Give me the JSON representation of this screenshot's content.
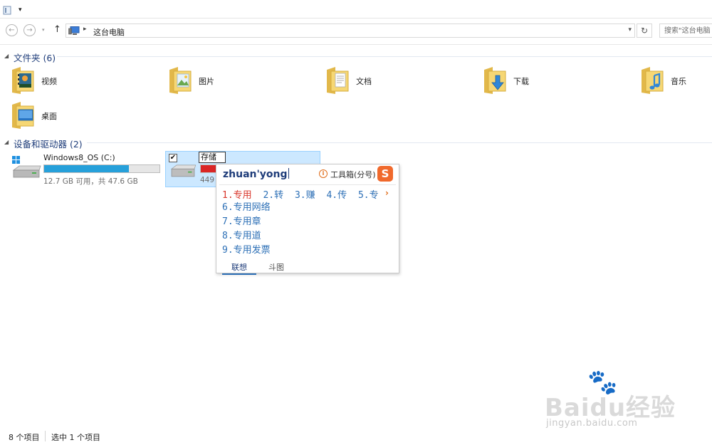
{
  "window": {
    "address_path": "这台电脑",
    "search_placeholder": "搜索\"这台电脑"
  },
  "sections": {
    "folders_title": "文件夹 (6)",
    "devices_title": "设备和驱动器 (2)"
  },
  "folders": [
    {
      "label": "视频",
      "icon": "videos-folder-icon"
    },
    {
      "label": "图片",
      "icon": "pictures-folder-icon"
    },
    {
      "label": "文档",
      "icon": "documents-folder-icon"
    },
    {
      "label": "下载",
      "icon": "downloads-folder-icon"
    },
    {
      "label": "音乐",
      "icon": "music-folder-icon"
    },
    {
      "label": "桌面",
      "icon": "desktop-folder-icon"
    }
  ],
  "drives": [
    {
      "name": "Windows8_OS (C:)",
      "free": "12.7 GB 可用，共 47.6 GB",
      "used_fraction": 0.733,
      "bar_color": "#26a0da"
    },
    {
      "rename_value": "存储",
      "free_partial": "449",
      "used_fraction": 0.95,
      "bar_color": "#da2626",
      "checked": true
    }
  ],
  "ime": {
    "composition": "zhuan'yong",
    "toolbox_label": "工具箱(分号)",
    "logo": "S",
    "candidates_row": [
      "1.专用",
      "2.转",
      "3.赚",
      "4.传",
      "5.专"
    ],
    "candidates_list": [
      "6.专用网络",
      "7.专用章",
      "8.专用道",
      "9.专用发票"
    ],
    "tabs": [
      "联想",
      "斗图"
    ],
    "pager_prev": "‹",
    "pager_next": "›"
  },
  "status": {
    "item_count": "8 个项目",
    "selected": "选中 1 个项目"
  },
  "watermark": {
    "brand": "Baidu经验",
    "site": "jingyan.baidu.com"
  }
}
